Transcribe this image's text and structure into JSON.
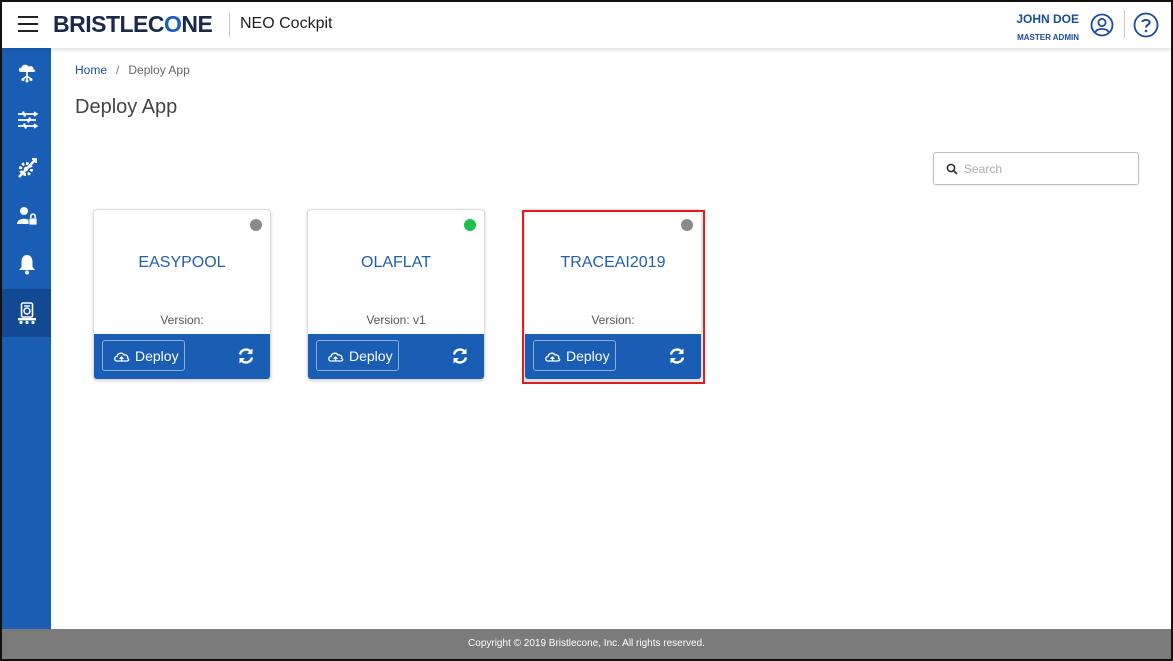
{
  "header": {
    "brand_part1": "BRISTLEC",
    "brand_part2": "O",
    "brand_part3": "NE",
    "app_title": "NEO Cockpit",
    "user_name": "JOHN DOE",
    "user_role": "MASTER ADMIN",
    "icons": [
      "menu-icon",
      "user-circle-icon",
      "help-icon"
    ]
  },
  "sidebar": {
    "items": [
      {
        "icon": "cloud-tree-icon"
      },
      {
        "icon": "sliders-icon"
      },
      {
        "icon": "tools-icon"
      },
      {
        "icon": "user-lock-icon"
      },
      {
        "icon": "bell-icon"
      },
      {
        "icon": "deploy-app-icon",
        "active": true
      }
    ]
  },
  "breadcrumb": {
    "home": "Home",
    "separator": "/",
    "current": "Deploy App"
  },
  "page": {
    "title": "Deploy App"
  },
  "search": {
    "placeholder": "Search",
    "value": ""
  },
  "apps": [
    {
      "name": "EASYPOOL",
      "version": "Version:",
      "status_color": "#8a8a8a",
      "deploy_label": "Deploy"
    },
    {
      "name": "OLAFLAT",
      "version": "Version: v1",
      "status_color": "#1fbf4f",
      "deploy_label": "Deploy"
    },
    {
      "name": "TRACEAI2019",
      "version": "Version:",
      "status_color": "#8a8a8a",
      "deploy_label": "Deploy"
    }
  ],
  "colors": {
    "primary": "#1a5db4",
    "highlight": "#e31b23",
    "footer": "#7b7b7b"
  },
  "footer": {
    "copyright": "Copyright © 2019 Bristlecone, Inc. All rights reserved."
  }
}
